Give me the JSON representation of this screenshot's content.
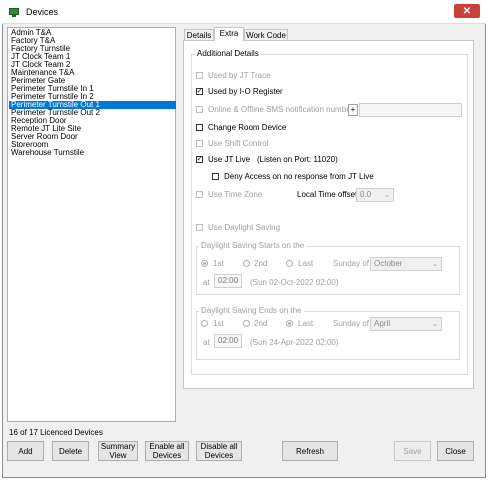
{
  "window": {
    "title": "Devices",
    "close_glyph": "✕"
  },
  "devices": {
    "items": [
      "Admin T&A",
      "Factory T&A",
      "Factory Turnstile",
      "JT Clock Team 1",
      "JT Clock Team 2",
      "Maintenance T&A",
      "Perimeter Gate",
      "Perimeter Turnstile In 1",
      "Perimeter Turnstile In 2",
      "Perimeter Turnstile Out 1",
      "Perimeter Turnstile Out 2",
      "Reception Door",
      "Remote JT Lite Site",
      "Server Room Door",
      "Storeroom",
      "Warehouse Turnstile"
    ],
    "selected_index": 9,
    "licence_status": "16 of 17 Licenced Devices"
  },
  "tabs": {
    "details": "Details",
    "extra": "Extra",
    "work_code": "Work Code",
    "active": "extra"
  },
  "extra": {
    "group_title": "Additional Details",
    "used_by_jt_trace": "Used by JT Trace",
    "used_by_io_register": "Used by I-O Register",
    "sms_notification": "Online & Offline SMS notification number",
    "sms_plus": "+",
    "change_room_device": "Change Room Device",
    "use_shift_control": "Use Shift Control",
    "use_jt_live": "Use JT Live",
    "jt_live_port": "(Listen on Port: 11020)",
    "deny_access": "Deny Access on no response from JT Live",
    "use_time_zone": "Use Time Zone",
    "local_time_offset_label": "Local Time offset",
    "local_time_offset_value": "0.0",
    "use_daylight_saving": "Use Daylight Saving",
    "check_mark": "✓",
    "dropdown_arrow": "⌄"
  },
  "dst_start": {
    "title": "Daylight Saving Starts on the",
    "opt_1st": "1st",
    "opt_2nd": "2nd",
    "opt_last": "Last",
    "selected": "1st",
    "sunday_of": "Sunday of",
    "month": "October",
    "at_label": "at",
    "time": "02:00",
    "summary": "(Sun 02-Oct-2022 02:00)"
  },
  "dst_end": {
    "title": "Daylight Saving Ends on the",
    "opt_1st": "1st",
    "opt_2nd": "2nd",
    "opt_last": "Last",
    "selected": "Last",
    "sunday_of": "Sunday of",
    "month": "April",
    "at_label": "at",
    "time": "02:00",
    "summary": "(Sun 24-Apr-2022 02:00)"
  },
  "buttons": {
    "add": "Add",
    "delete": "Delete",
    "summary_view": "Summary View",
    "enable_all": "Enable all Devices",
    "disable_all": "Disable all Devices",
    "refresh": "Refresh",
    "save": "Save",
    "close": "Close"
  },
  "icons": {
    "app": "devices-window-icon",
    "close": "close-icon",
    "check": "checkmark-icon",
    "dropdown": "chevron-down-icon"
  },
  "colors": {
    "selection": "#0078d7",
    "close_button": "#c9413a",
    "window_bg": "#f0f0f0"
  }
}
